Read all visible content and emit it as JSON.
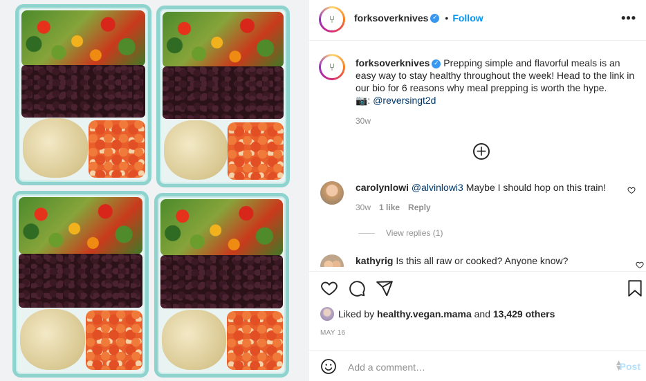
{
  "post": {
    "author": "forksoverknives",
    "follow_label": "Follow",
    "separator": "•",
    "more_label": "•••"
  },
  "caption": {
    "author": "forksoverknives",
    "text": "Prepping simple and flavorful meals is an easy way to stay healthy throughout the week! Head to the link in our bio for 6 reasons why meal prepping is worth the hype.",
    "camera_emoji": "📷:",
    "credit": "@reversingt2d",
    "time": "30w"
  },
  "load_more_label": "+",
  "comments": [
    {
      "author": "carolynlowi",
      "mention": "@alvinlowi3",
      "text": "Maybe I should hop on this train!",
      "time": "30w",
      "likes": "1 like",
      "reply_label": "Reply",
      "view_replies": "View replies (1)"
    },
    {
      "author": "kathyrig",
      "text": "Is this all raw or cooked? Anyone know?"
    }
  ],
  "likes": {
    "prefix": "Liked by",
    "user": "healthy.vegan.mama",
    "joiner": "and",
    "others": "13,429 others"
  },
  "date": "MAY 16",
  "comment_box": {
    "placeholder": "Add a comment…",
    "post_label": "Post"
  },
  "colors": {
    "accent": "#0095f6",
    "verified": "#3897f0",
    "secondary_text": "#8e8e8e",
    "post_disabled": "#b2dffc"
  },
  "icons": [
    "verified-badge-icon",
    "more-options-icon",
    "add-circle-icon",
    "heart-icon",
    "comment-icon",
    "share-icon",
    "bookmark-icon",
    "emoji-icon"
  ]
}
